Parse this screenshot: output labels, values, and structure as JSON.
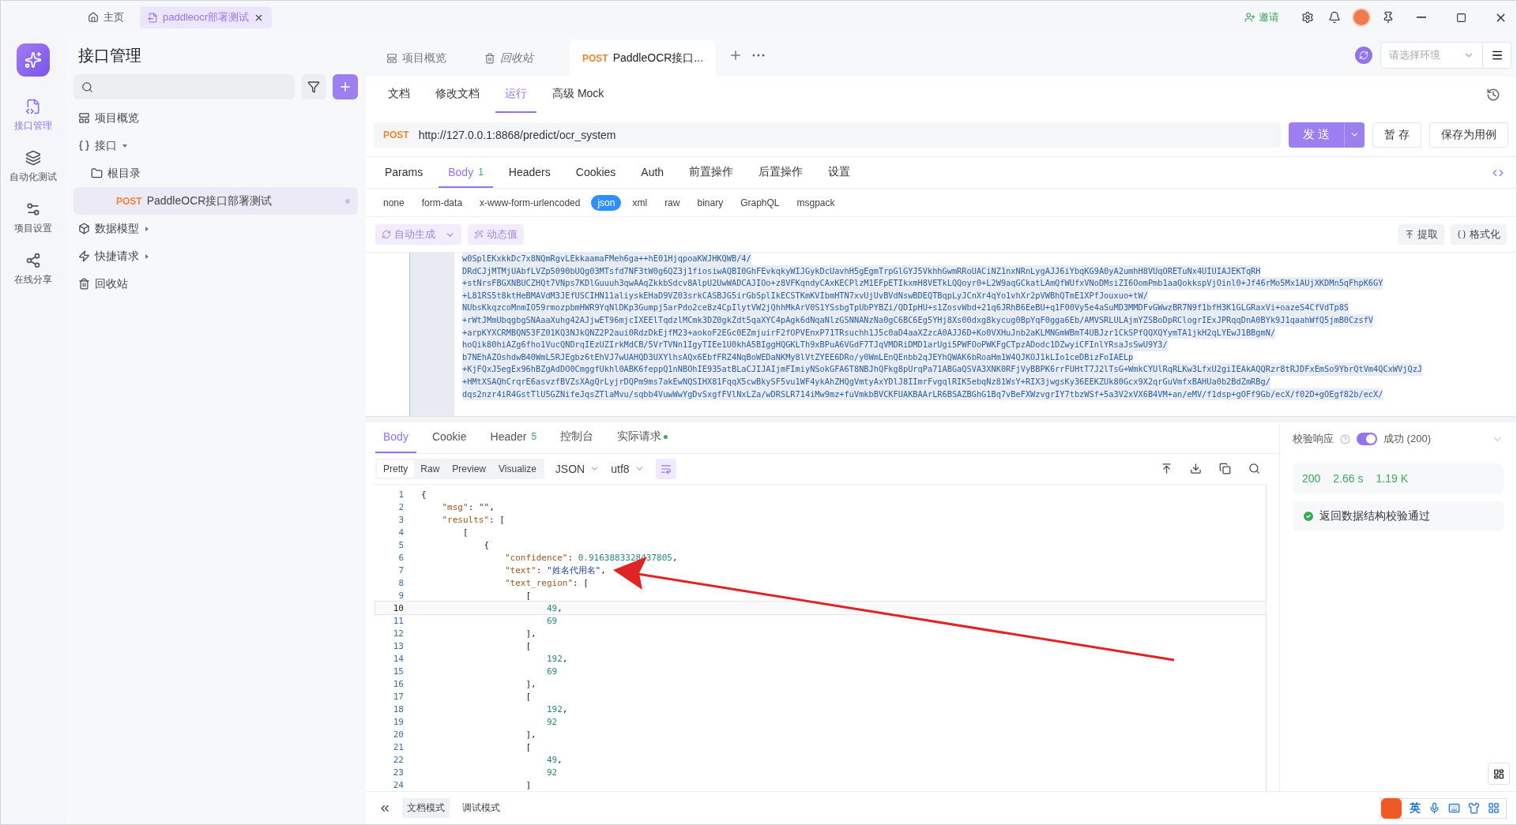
{
  "title_bar": {
    "tabs": [
      {
        "kind": "home",
        "label": "主页",
        "selected": false
      },
      {
        "kind": "doc",
        "label": "paddleocr部署测试",
        "selected": true
      }
    ],
    "invite": "邀请"
  },
  "rail": {
    "items": [
      {
        "kind": "api",
        "label": "接口管理",
        "selected": true
      },
      {
        "kind": "auto",
        "label": "自动化测试",
        "selected": false
      },
      {
        "kind": "settings",
        "label": "项目设置",
        "selected": false
      },
      {
        "kind": "share",
        "label": "在线分享",
        "selected": false
      }
    ]
  },
  "sidebar": {
    "title": "接口管理",
    "tree": [
      {
        "kind": "overview",
        "label": "项目概览",
        "selected": false
      },
      {
        "kind": "api",
        "label": "接口",
        "selected": false,
        "expanded": true,
        "children": [
          {
            "kind": "folder",
            "label": "根目录",
            "selected": false,
            "children": [
              {
                "kind": "request",
                "method": "POST",
                "label": "PaddleOCR接口部署测试",
                "selected": true
              }
            ]
          }
        ]
      },
      {
        "kind": "model",
        "label": "数据模型",
        "selected": false,
        "expanded": false
      },
      {
        "kind": "quick",
        "label": "快捷请求",
        "selected": false,
        "expanded": false
      },
      {
        "kind": "trash",
        "label": "回收站",
        "selected": false
      }
    ]
  },
  "main_tabs": [
    {
      "kind": "overview",
      "label": "项目概览",
      "selected": false
    },
    {
      "kind": "trash",
      "label": "回收站",
      "selected": false
    },
    {
      "kind": "request",
      "method": "POST",
      "label": "PaddleOCR接口...",
      "selected": true
    }
  ],
  "environment": {
    "placeholder": "请选择环境"
  },
  "sub_tabs": [
    {
      "label": "文档",
      "selected": false
    },
    {
      "label": "修改文档",
      "selected": false
    },
    {
      "label": "运行",
      "selected": true
    },
    {
      "label": "高级 Mock",
      "selected": false
    }
  ],
  "request": {
    "method": "POST",
    "url": "http://127.0.0.1:8868/predict/ocr_system",
    "send": "发 送",
    "save_draft": "暂 存",
    "save_case": "保存为用例"
  },
  "param_tabs": [
    {
      "label": "Params",
      "selected": false
    },
    {
      "label": "Body",
      "badge": "1",
      "selected": true
    },
    {
      "label": "Headers",
      "selected": false
    },
    {
      "label": "Cookies",
      "selected": false
    },
    {
      "label": "Auth",
      "selected": false
    },
    {
      "label": "前置操作",
      "selected": false
    },
    {
      "label": "后置操作",
      "selected": false
    },
    {
      "label": "设置",
      "selected": false
    }
  ],
  "body_types": [
    {
      "label": "none",
      "selected": false
    },
    {
      "label": "form-data",
      "selected": false
    },
    {
      "label": "x-www-form-urlencoded",
      "selected": false
    },
    {
      "label": "json",
      "selected": true
    },
    {
      "label": "xml",
      "selected": false
    },
    {
      "label": "raw",
      "selected": false
    },
    {
      "label": "binary",
      "selected": false
    },
    {
      "label": "GraphQL",
      "selected": false
    },
    {
      "label": "msgpack",
      "selected": false
    }
  ],
  "body_tools": {
    "auto": "自动生成",
    "dynamic": "动态值",
    "extract": "提取",
    "format": "格式化"
  },
  "body_lines": [
    "w0SplEKxkkDc7x8NQmRgvLEkkaamaFMeh6ga++hE01HjqpoaKWJHKQWB/4/",
    "DRdCJjMTMjUAbfLVZp5090bUQg03MTsfd7NF3tW0g6QZ3j1fiosiwAQBI0GhFEvkqkyWIJGykDcUavhH5gEgmTrpGlGYJ5VkhhGwmRRoUACiNZ1nxNRnLygAJJ6iYbqKG9A0yA2umhH8VUqORETuNx4UIUIAJEKTqRH",
    "+stNrsFBGXNBUCZHQt7VNps7KDlGuuuh3qwAAqZkkbSdcv8AlpU2UwWADCAJIOo+z8VFKqndyCAxKECPlzM1EFpETIkxmH8VETkLQQoyr0+L2W9aqGCkatLAmQfWUfxVNoDMsiZI6OomPmb1aaQokkspVjOinl0+Jf46rMo5Mx1AUjXKDMn5qFhpK6GY",
    "+L81RS5t8ktHeBMAVdM3JEfUSCIHN11aliyskEHaD9VZ03srkCASBJG5irGbSplIkECSTKmKVIbmHTN7xvUjUvBVdNswBDEQTBqpLyJCnXr4qYo1vhXr2pVWBhQTmE1XPfJouxuo+tW/",
    "NUbsKkqzcoMnmIO59rmozpbmHWR9YqNlDKp3Gumpj5arPdo2ce8z4CpIlytVW2jQhhMkArV0S1YSsbgTpUbPYBZi/QDIpHU+s1ZosvWbd+21q6JRhB6EeBU+q1F00Vy5e4aSuMD3MMDFvGWwzBR7N9f1bfH3K1GLGRaxVi+oazeS4CfVdTp8S",
    "+rWtJMmUbqgbgSNAaaXuhg42AJjwET96mjcIXEElTqdzlMCmk3DZ0gkZdt5qaXYC4pAgk6dNqaNlzGSNNANzNa0gC6BC6Eg5YHj8Xs00dxg8kycug0BpYqF0gga6Eb/AMVSRLULAjmYZSBoDpRClogrIExJPRqqDnA0BYk9J1qaahWfQ5jmB0CzsfV",
    "+arpKYXCRMBQN53FZ01KQ3NJkQNZ2P2aui0RdzDkEjfM23+aokoF2EGc0EZmjuirF2fOPVEnxP71TRsuchh1J5c0aD4aaXZzcA0AJJ6D+Ko0VXHuJnb2aKLMNGmWBmT4UBJzr1CkSPfQQXQYymTA1jkH2qLYEwJ1BBgmN/",
    "hoQik80hiAZg6fho1VucQNDrqIEzUZIrkMdCB/5VrTVNn1IgyTIEe1U0khA5BIggHQGKLTh9xBPuA6VGdF7TJqVMDRiDMD1arUgi5PWFOoPWKFgCTpzADodc1DZwyiCFInlYRsaJsSwU9Y3/",
    "b7NEhAZOshdwB40WmL5RJEgbz6tEhVJ7wUAHQD3UXYlhsAQx6EbfFRZ4NqBoWEDaNKMy8lVtZYEE6DRo/y0WmLEnQEnbb2qJEYhQWAK6bRoaHm1W4QJKOJ1kLIo1ceDBizFoIAELp",
    "+KjFQxJ5egEx96hBZgAdDO0CmggfUkhl0ABK6feppQ1nNBOhIE935atBLaCJIJAIjmFImiyNSokGFA6T8NBJhQFkg8pUrqPa71ABGaQSVA3XNK0RFjVyBBPK6rrFUHtT7J2lTsG+WmkCYUlRqRLKw3LfxU2giIEAkAQQRzr8tRJDFxEmSo9YbrQtVm4QCxWVjQzJ",
    "+HMtXSAQhCrqrE6asvzfBVZsXAgQrLyjrDQPm9ms7akEwNQSIHX81FqqX5cwBkySF5vu1WF4ykAhZHQgVmtyAxYDlJ8IImrFvgqlRIK5ebqNz81WsY+RIX3jwgsKy36EEKZUk80Gcx9X2qrGuVmfxBAHUa0b2BdZmRBg/",
    "dqs2nzr4iR4GstTlU5GZNifeJqsZTlaMvu/sqbb4VuwWwYgDvSxgfFVlNxLZa/wDRSLR714iMw9mz+fuVmkbBVCKFUAKBAArLR6BSAZBGhG1Bq7vBeFXWzvgrIY7tbzWSf+5a3V2xVX6B4VM+an/eMV/f1dsp+gOFf9Gb/ecX/f02D+gOEgf82b/ecX/"
  ],
  "response": {
    "tabs": [
      {
        "label": "Body",
        "selected": true,
        "indicator": false
      },
      {
        "label": "Cookie",
        "selected": false,
        "indicator": false
      },
      {
        "label": "Header",
        "badge": "5",
        "selected": false,
        "indicator": false
      },
      {
        "label": "控制台",
        "selected": false,
        "indicator": false
      },
      {
        "label": "实际请求",
        "selected": false,
        "indicator": true
      }
    ],
    "views": [
      {
        "label": "Pretty",
        "selected": true
      },
      {
        "label": "Raw",
        "selected": false
      },
      {
        "label": "Preview",
        "selected": false
      },
      {
        "label": "Visualize",
        "selected": false
      }
    ],
    "format": "JSON",
    "encoding": "utf8",
    "lines": [
      {
        "number": "1",
        "text": "{",
        "selected": false
      },
      {
        "number": "2",
        "text": "    \"msg\": \"\",",
        "selected": false
      },
      {
        "number": "3",
        "text": "    \"results\": [",
        "selected": false
      },
      {
        "number": "4",
        "text": "        [",
        "selected": false
      },
      {
        "number": "5",
        "text": "            {",
        "selected": false
      },
      {
        "number": "6",
        "text": "                \"confidence\": 0.9163883328437805,",
        "selected": false
      },
      {
        "number": "7",
        "text": "                \"text\": \"姓名代用名\",",
        "selected": false
      },
      {
        "number": "8",
        "text": "                \"text_region\": [",
        "selected": false
      },
      {
        "number": "9",
        "text": "                    [",
        "selected": false
      },
      {
        "number": "10",
        "text": "                        49,",
        "selected": true
      },
      {
        "number": "11",
        "text": "                        69",
        "selected": false
      },
      {
        "number": "12",
        "text": "                    ],",
        "selected": false
      },
      {
        "number": "13",
        "text": "                    [",
        "selected": false
      },
      {
        "number": "14",
        "text": "                        192,",
        "selected": false
      },
      {
        "number": "15",
        "text": "                        69",
        "selected": false
      },
      {
        "number": "16",
        "text": "                    ],",
        "selected": false
      },
      {
        "number": "17",
        "text": "                    [",
        "selected": false
      },
      {
        "number": "18",
        "text": "                        192,",
        "selected": false
      },
      {
        "number": "19",
        "text": "                        92",
        "selected": false
      },
      {
        "number": "20",
        "text": "                    ],",
        "selected": false
      },
      {
        "number": "21",
        "text": "                    [",
        "selected": false
      },
      {
        "number": "22",
        "text": "                        49,",
        "selected": false
      },
      {
        "number": "23",
        "text": "                        92",
        "selected": false
      },
      {
        "number": "24",
        "text": "                    ]",
        "selected": false
      }
    ]
  },
  "validation": {
    "label": "校验响应",
    "on": true,
    "status": "成功 (200)",
    "code": "200",
    "time": "2.66 s",
    "size": "1.19 K",
    "result": "返回数据结构校验通过"
  },
  "footer": {
    "modes": [
      {
        "label": "文档模式",
        "selected": true
      },
      {
        "label": "调试模式",
        "selected": false
      }
    ]
  },
  "ime": {
    "language": "英"
  }
}
